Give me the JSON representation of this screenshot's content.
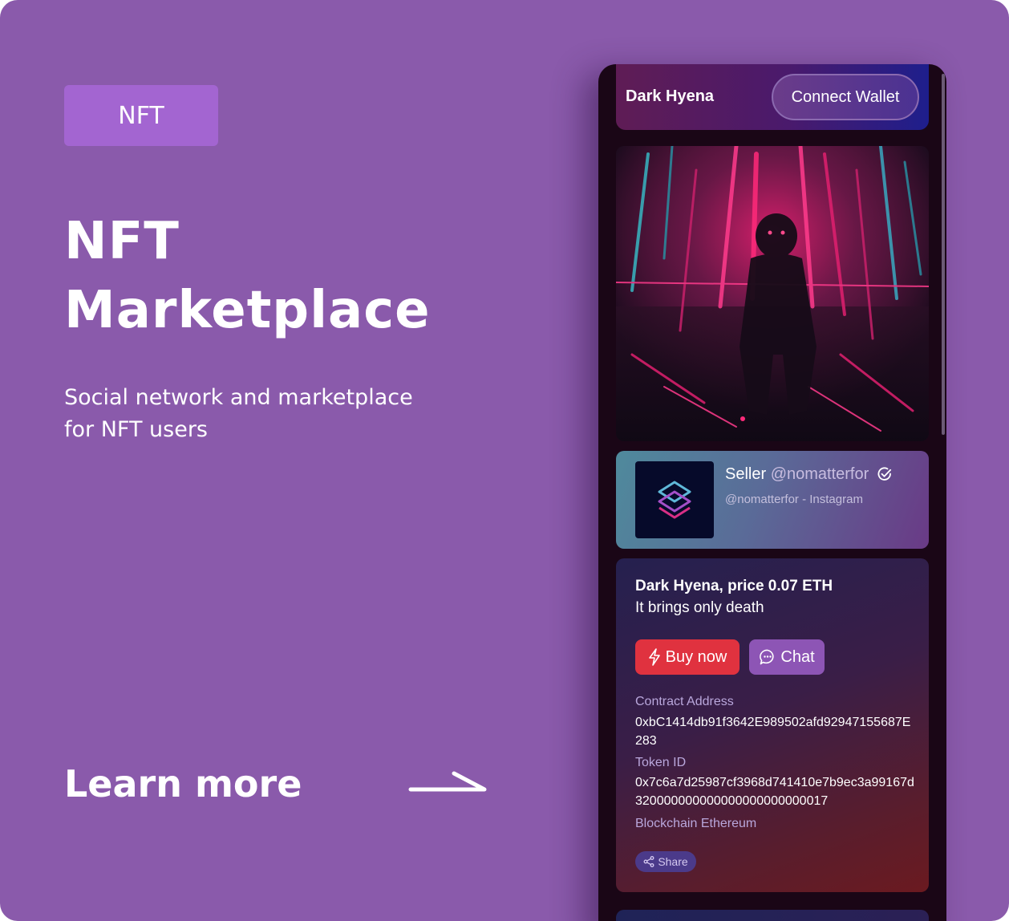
{
  "tag": "NFT",
  "title_line1": "NFT",
  "title_line2": "Marketplace",
  "subtitle": "Social network and marketplace for NFT users",
  "learn_more": "Learn more",
  "app": {
    "brand": "Dark Hyena",
    "connect_wallet": "Connect Wallet"
  },
  "seller": {
    "label": "Seller",
    "handle": "@nomatterfor",
    "subline": "@nomatterfor - Instagram"
  },
  "item": {
    "title": "Dark Hyena, price 0.07 ETH",
    "description": "It brings only death",
    "buy_label": "Buy now",
    "chat_label": "Chat",
    "contract_label": "Contract Address",
    "contract_value": "0xbC1414db91f3642E989502afd92947155687E283",
    "token_label": "Token ID",
    "token_value": "0x7c6a7d25987cf3968d741410e7b9ec3a99167d320000000000000000000000017",
    "blockchain_label": "Blockchain",
    "blockchain_value": "Ethereum",
    "share_label": "Share"
  },
  "colors": {
    "background": "#8a5aab",
    "tag": "#a365d1",
    "buy": "#e0323f",
    "chat": "#8d55b5"
  }
}
